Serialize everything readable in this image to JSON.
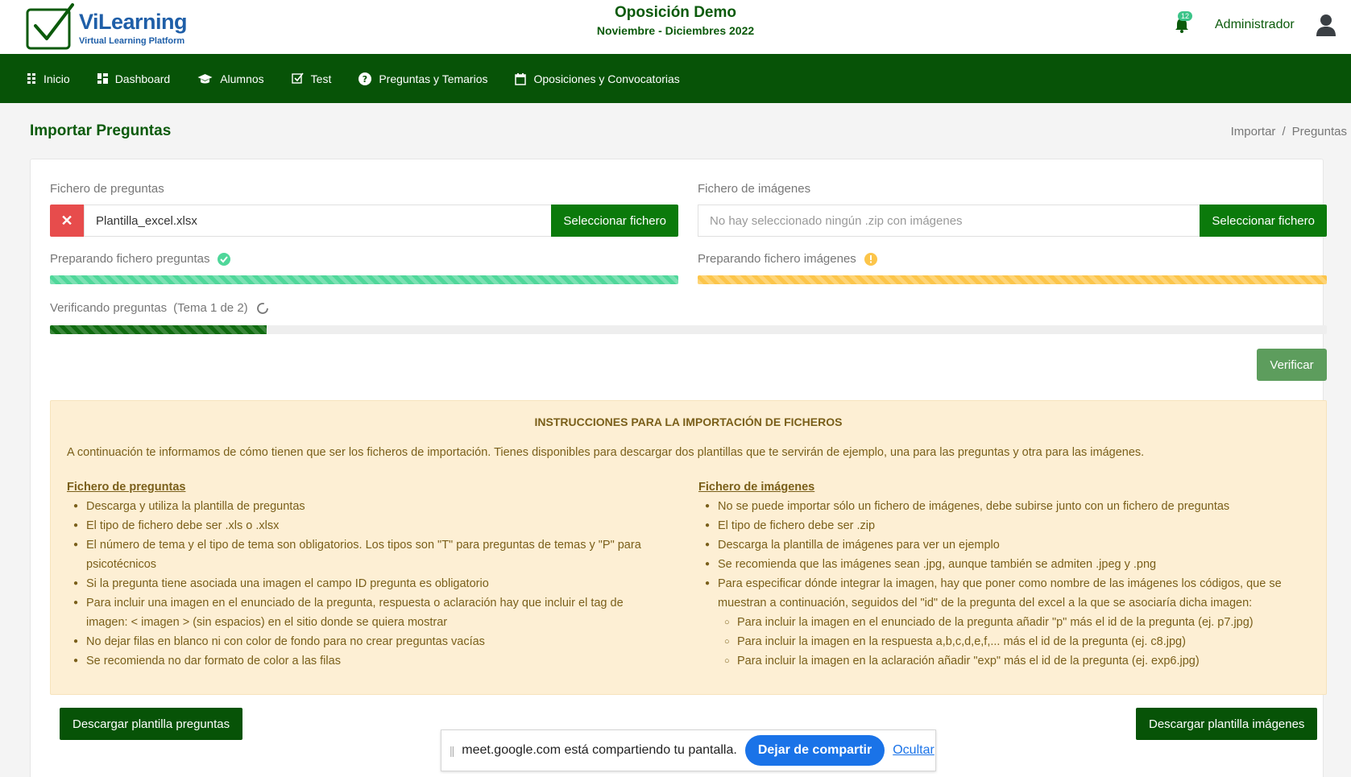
{
  "logo": {
    "name": "ViLearning",
    "subtitle": "Virtual Learning Platform"
  },
  "header": {
    "title": "Oposición Demo",
    "subtitle": "Noviembre - Diciembres 2022",
    "notification_count": "12",
    "user_name": "Administrador"
  },
  "nav": [
    {
      "label": "Inicio",
      "icon": "grid-icon"
    },
    {
      "label": "Dashboard",
      "icon": "dashboard-icon"
    },
    {
      "label": "Alumnos",
      "icon": "graduation-cap-icon"
    },
    {
      "label": "Test",
      "icon": "checkbox-icon"
    },
    {
      "label": "Preguntas y Temarios",
      "icon": "question-circle-icon"
    },
    {
      "label": "Oposiciones y Convocatorias",
      "icon": "calendar-icon"
    }
  ],
  "page": {
    "title": "Importar Preguntas",
    "breadcrumb": [
      "Importar",
      "Preguntas"
    ]
  },
  "questions_file": {
    "label": "Fichero de preguntas",
    "value": "Plantilla_excel.xlsx",
    "button": "Seleccionar fichero",
    "status": "Preparando fichero preguntas",
    "progress": 1.0
  },
  "images_file": {
    "label": "Fichero de imágenes",
    "placeholder": "No hay seleccionado ningún .zip con imágenes",
    "button": "Seleccionar fichero",
    "status": "Preparando fichero imágenes",
    "progress": 1.0
  },
  "verify": {
    "status": "Verificando preguntas",
    "detail": "(Tema 1 de 2)",
    "progress": 0.17,
    "button": "Verificar"
  },
  "instructions": {
    "title": "INSTRUCCIONES PARA LA IMPORTACIÓN DE FICHEROS",
    "intro": "A continuación te informamos de cómo tienen que ser los ficheros de importación. Tienes disponibles para descargar dos plantillas que te servirán de ejemplo, una para las preguntas y otra para las imágenes.",
    "questions": {
      "title": "Fichero de preguntas",
      "items": [
        "Descarga y utiliza la plantilla de preguntas",
        "El tipo de fichero debe ser .xls o .xlsx",
        "El número de tema y el tipo de tema son obligatorios. Los tipos son \"T\" para preguntas de temas y \"P\" para psicotécnicos",
        "Si la pregunta tiene asociada una imagen el campo ID pregunta es obligatorio",
        "Para incluir una imagen en el enunciado de la pregunta, respuesta o aclaración hay que incluir el tag de imagen: < imagen > (sin espacios) en el sitio donde se quiera mostrar",
        "No dejar filas en blanco ni con color de fondo para no crear preguntas vacías",
        "Se recomienda no dar formato de color a las filas"
      ]
    },
    "images": {
      "title": "Fichero de imágenes",
      "items": [
        "No se puede importar sólo un fichero de imágenes, debe subirse junto con un fichero de preguntas",
        "El tipo de fichero debe ser .zip",
        "Descarga la plantilla de imágenes para ver un ejemplo",
        "Se recomienda que las imágenes sean .jpg, aunque también se admiten .jpeg y .png",
        "Para especificar dónde integrar la imagen, hay que poner como nombre de las imágenes los códigos, que se muestran a continuación, seguidos del \"id\" de la pregunta del excel a la que se asociaría dicha imagen:"
      ],
      "subitems": [
        "Para incluir la imagen en el enunciado de la pregunta añadir \"p\" más el id de la pregunta (ej. p7.jpg)",
        "Para incluir la imagen en la respuesta a,b,c,d,e,f,... más el id de la pregunta (ej. c8.jpg)",
        "Para incluir la imagen en la aclaración añadir \"exp\" más el id de la pregunta (ej. exp6.jpg)"
      ]
    }
  },
  "downloads": {
    "questions": "Descargar plantilla preguntas",
    "images": "Descargar plantilla imágenes"
  },
  "share_bar": {
    "text": "meet.google.com está compartiendo tu pantalla.",
    "stop": "Dejar de compartir",
    "hide": "Ocultar"
  },
  "colors": {
    "brand_green": "#075307",
    "button_green": "#0b7a0b",
    "success": "#4fd79a",
    "warning": "#fcc54a",
    "danger": "#e74c4c"
  }
}
